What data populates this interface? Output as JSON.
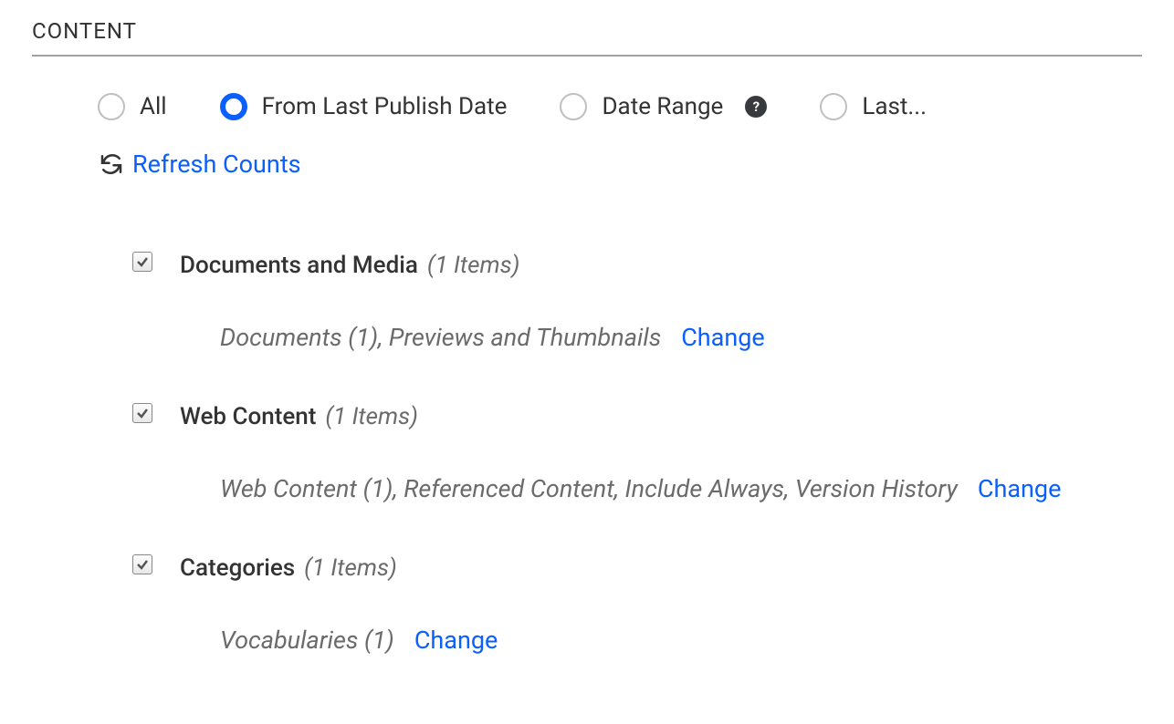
{
  "section": {
    "title": "CONTENT"
  },
  "radios": {
    "all": "All",
    "from_last_publish": "From Last Publish Date",
    "date_range": "Date Range",
    "last": "Last..."
  },
  "refresh": {
    "label": "Refresh Counts"
  },
  "items": [
    {
      "name": "Documents and Media",
      "count_label": "(1 Items)",
      "detail": "Documents (1), Previews and Thumbnails",
      "change": "Change"
    },
    {
      "name": "Web Content",
      "count_label": "(1 Items)",
      "detail": "Web Content (1), Referenced Content, Include Always, Version History",
      "change": "Change"
    },
    {
      "name": "Categories",
      "count_label": "(1 Items)",
      "detail": "Vocabularies (1)",
      "change": "Change"
    }
  ]
}
